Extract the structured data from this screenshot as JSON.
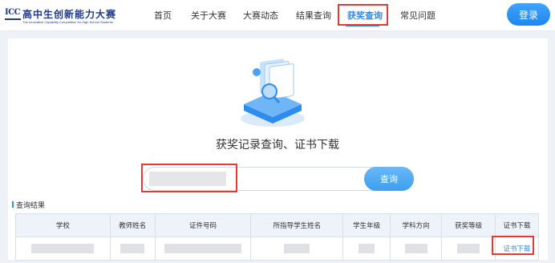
{
  "logo": {
    "mark": "ICC",
    "cn": "高中生创新能力大赛",
    "en": "The Innovative Capability Competition for High School Students",
    "color": "#1f3a8a"
  },
  "nav": {
    "items": [
      {
        "label": "首页"
      },
      {
        "label": "关于大赛"
      },
      {
        "label": "大赛动态"
      },
      {
        "label": "结果查询"
      },
      {
        "label": "获奖查询",
        "active": true
      },
      {
        "label": "常见问题"
      }
    ],
    "login_label": "登录"
  },
  "page": {
    "title": "获奖记录查询、证书下载",
    "illustration_icon": "document-search-icon"
  },
  "search": {
    "value": "",
    "button_label": "查询"
  },
  "results": {
    "label": "查询结果",
    "columns": [
      "学校",
      "教师姓名",
      "证件号码",
      "所指导学生姓名",
      "学生年级",
      "学科方向",
      "获奖等级",
      "证书下载"
    ],
    "rows": [
      {
        "download_label": "证书下载"
      }
    ]
  },
  "colors": {
    "accent": "#2e8bf0",
    "highlight": "#e53935",
    "table_header_bg": "#eef3fa"
  }
}
